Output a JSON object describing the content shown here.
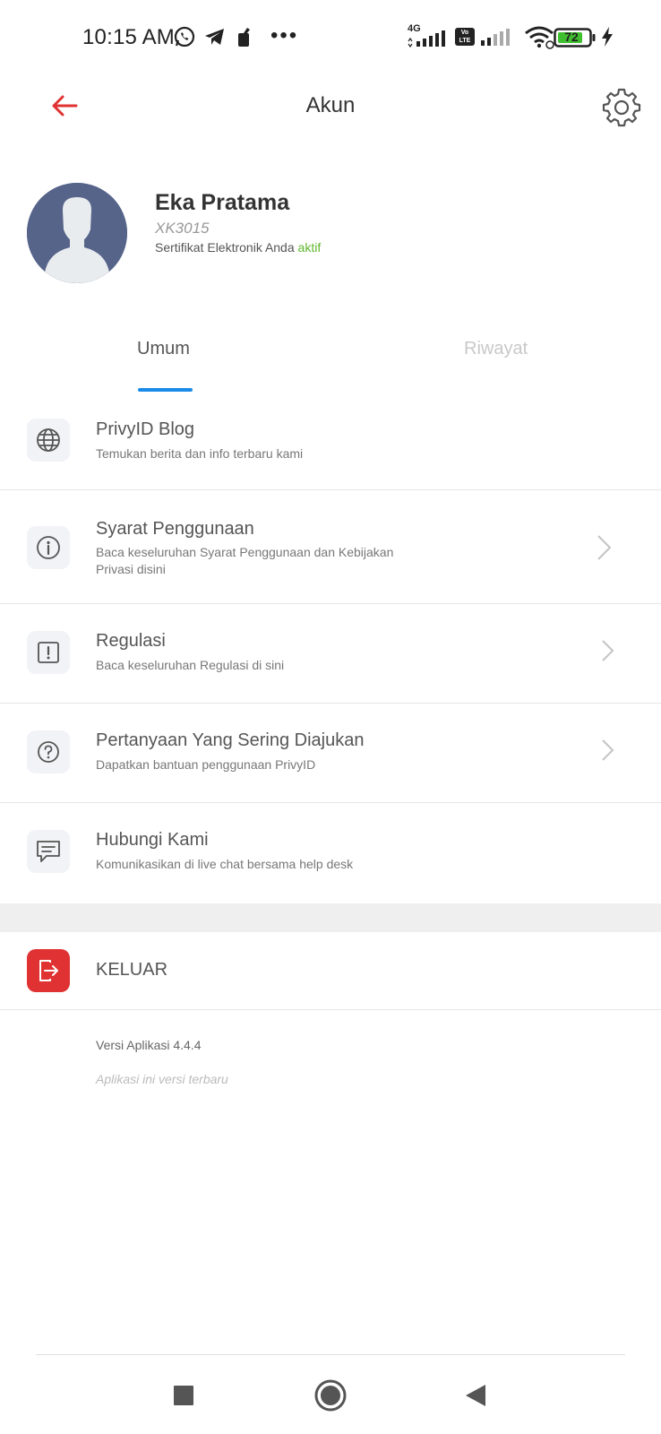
{
  "status_bar": {
    "time": "10:15 AM",
    "network_label": "4G",
    "volte_label": "Vo LTE",
    "battery_level": "72"
  },
  "header": {
    "title": "Akun"
  },
  "profile": {
    "name": "Eka Pratama",
    "user_id": "XK3015",
    "cert_text": "Sertifikat Elektronik Anda",
    "cert_status": "aktif"
  },
  "tabs": [
    {
      "label": "Umum",
      "active": true
    },
    {
      "label": "Riwayat",
      "active": false
    }
  ],
  "menu": [
    {
      "title": "PrivyID Blog",
      "desc": "Temukan berita dan info terbaru kami",
      "icon": "globe-icon"
    },
    {
      "title": "Syarat Penggunaan",
      "desc": "Baca keseluruhan Syarat Penggunaan dan Kebijakan Privasi disini",
      "icon": "info-icon"
    },
    {
      "title": "Regulasi",
      "desc": "Baca keseluruhan Regulasi di sini",
      "icon": "alert-icon"
    },
    {
      "title": "Pertanyaan Yang Sering Diajukan",
      "desc": "Dapatkan bantuan penggunaan PrivyID",
      "icon": "help-icon"
    },
    {
      "title": "Hubungi Kami",
      "desc": "Komunikasikan di live chat bersama help desk",
      "icon": "chat-icon"
    }
  ],
  "logout": {
    "label": "KELUAR"
  },
  "footer": {
    "version": "Versi Aplikasi 4.4.4",
    "version_note": "Aplikasi ini versi terbaru"
  },
  "colors": {
    "accent_red": "#e03232",
    "tab_active": "#1a8be8",
    "cert_active": "#5fb82e"
  }
}
